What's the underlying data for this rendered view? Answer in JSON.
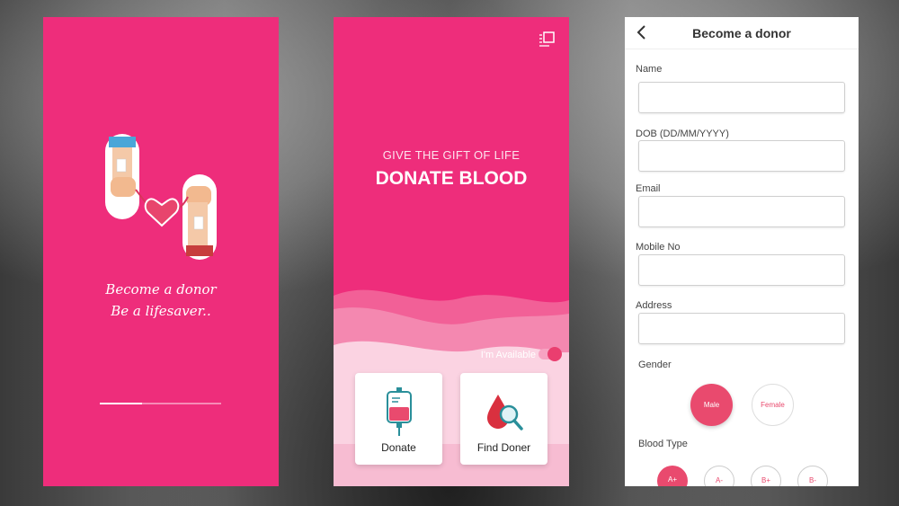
{
  "splash": {
    "line1": "Become a donor",
    "line2": "Be a lifesaver..",
    "progress": 0.35,
    "colors": {
      "background": "#ee2d7b"
    }
  },
  "home": {
    "layout_icon": "layout-icon",
    "subtitle": "GIVE THE GIFT OF LIFE",
    "title": "DONATE BLOOD",
    "availability_label": "I'm Available",
    "availability_on": true,
    "cards": [
      {
        "label": "Donate",
        "icon": "blood-bag-icon"
      },
      {
        "label": "Find Doner",
        "icon": "blood-search-icon"
      }
    ],
    "colors": {
      "background": "#ee2d7b",
      "accent": "#ea3e6f"
    }
  },
  "form": {
    "back_icon": "chevron-left-icon",
    "title": "Become a donor",
    "fields": [
      {
        "label": "Name",
        "value": ""
      },
      {
        "label": "DOB (DD/MM/YYYY)",
        "value": ""
      },
      {
        "label": "Email",
        "value": ""
      },
      {
        "label": "Mobile No",
        "value": ""
      },
      {
        "label": "Address",
        "value": ""
      }
    ],
    "gender_label": "Gender",
    "gender_options": [
      "Male",
      "Female"
    ],
    "gender_selected": "Male",
    "blood_type_label": "Blood Type",
    "blood_types": [
      "A+",
      "A-",
      "B+",
      "B-"
    ],
    "blood_type_selected": "A+",
    "colors": {
      "accent": "#e94a6e"
    }
  }
}
